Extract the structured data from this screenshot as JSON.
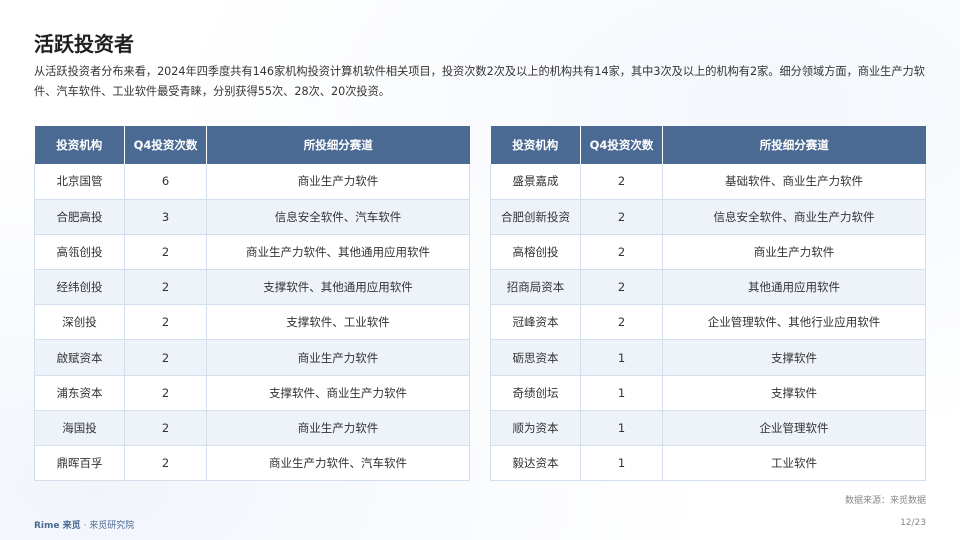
{
  "title": "活跃投资者",
  "intro": "从活跃投资者分布来看，2024年四季度共有146家机构投资计算机软件相关项目，投资次数2次及以上的机构共有14家，其中3次及以上的机构有2家。细分领域方面，商业生产力软件、汽车软件、工业软件最受青睐，分别获得55次、28次、20次投资。",
  "table_headers": [
    "投资机构",
    "Q4投资次数",
    "所投细分赛道"
  ],
  "left_table": [
    {
      "org": "北京国管",
      "count": "6",
      "tracks": "商业生产力软件"
    },
    {
      "org": "合肥高投",
      "count": "3",
      "tracks": "信息安全软件、汽车软件"
    },
    {
      "org": "高瓴创投",
      "count": "2",
      "tracks": "商业生产力软件、其他通用应用软件"
    },
    {
      "org": "经纬创投",
      "count": "2",
      "tracks": "支撑软件、其他通用应用软件"
    },
    {
      "org": "深创投",
      "count": "2",
      "tracks": "支撑软件、工业软件"
    },
    {
      "org": "啟赋资本",
      "count": "2",
      "tracks": "商业生产力软件"
    },
    {
      "org": "浦东资本",
      "count": "2",
      "tracks": "支撑软件、商业生产力软件"
    },
    {
      "org": "海国投",
      "count": "2",
      "tracks": "商业生产力软件"
    },
    {
      "org": "鼎晖百孚",
      "count": "2",
      "tracks": "商业生产力软件、汽车软件"
    }
  ],
  "right_table": [
    {
      "org": "盛景嘉成",
      "count": "2",
      "tracks": "基础软件、商业生产力软件"
    },
    {
      "org": "合肥创新投资",
      "count": "2",
      "tracks": "信息安全软件、商业生产力软件"
    },
    {
      "org": "高榕创投",
      "count": "2",
      "tracks": "商业生产力软件"
    },
    {
      "org": "招商局资本",
      "count": "2",
      "tracks": "其他通用应用软件"
    },
    {
      "org": "冠峰资本",
      "count": "2",
      "tracks": "企业管理软件、其他行业应用软件"
    },
    {
      "org": "砺思资本",
      "count": "1",
      "tracks": "支撑软件"
    },
    {
      "org": "奇绩创坛",
      "count": "1",
      "tracks": "支撑软件"
    },
    {
      "org": "顺为资本",
      "count": "1",
      "tracks": "企业管理软件"
    },
    {
      "org": "毅达资本",
      "count": "1",
      "tracks": "工业软件"
    }
  ],
  "source": "数据来源：来觅数据",
  "footer": {
    "brand": "Rime 来觅",
    "org": "· 来觅研究院"
  },
  "page_number": "12/23",
  "colors": {
    "header_bg": "#4a6a94",
    "alt_row": "#eef3fa",
    "border": "#d4dfee"
  }
}
